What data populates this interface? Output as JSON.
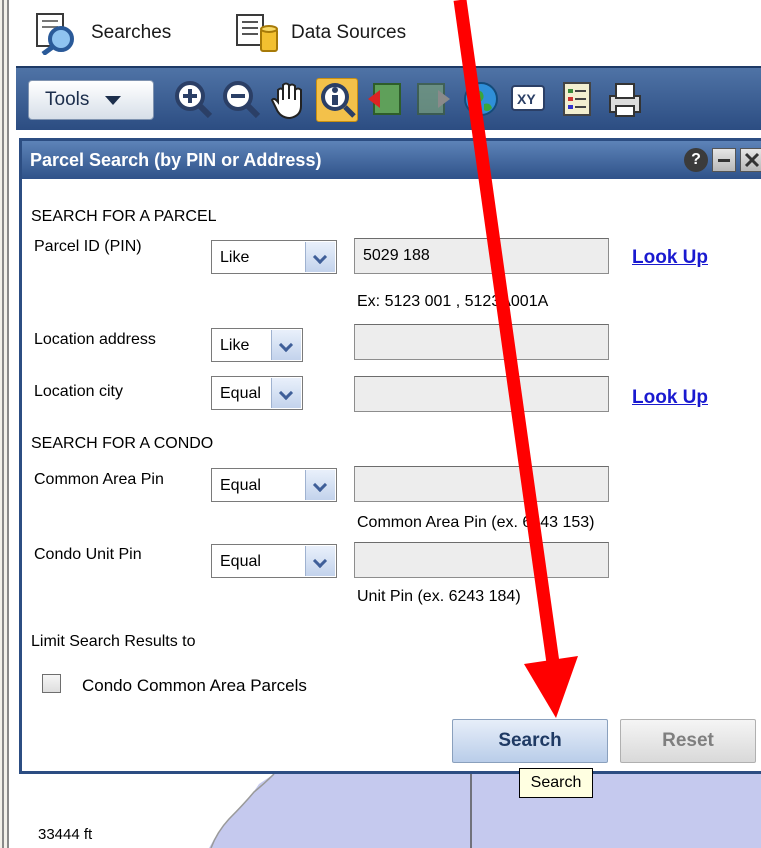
{
  "top_tabs": [
    {
      "label": "Searches",
      "icon": "search-magnifier-icon"
    },
    {
      "label": "Data Sources",
      "icon": "database-icon"
    }
  ],
  "toolbar": {
    "tools_label": "Tools",
    "tools": [
      "zoom-in-icon",
      "zoom-out-icon",
      "pan-hand-icon",
      "identify-info-icon",
      "previous-extent-icon",
      "next-extent-icon",
      "full-extent-globe-icon",
      "xy-coordinate-icon",
      "legend-list-icon",
      "print-icon"
    ],
    "active_tool": "identify-info-icon"
  },
  "panel": {
    "title": "Parcel Search (by PIN or Address)",
    "controls": [
      "help-icon",
      "minimize-icon",
      "close-icon"
    ]
  },
  "parcel_section": {
    "heading": "SEARCH FOR A PARCEL",
    "pin": {
      "label": "Parcel ID (PIN)",
      "operator": "Like",
      "value": "5029 188",
      "lookup": "Look Up",
      "hint": "Ex: 5123 001 , 5123A001A"
    },
    "address": {
      "label": "Location address",
      "operator": "Like",
      "value": ""
    },
    "city": {
      "label": "Location city",
      "operator": "Equal",
      "value": "",
      "lookup": "Look Up"
    }
  },
  "condo_section": {
    "heading": "SEARCH FOR A CONDO",
    "common_area": {
      "label": "Common Area Pin",
      "operator": "Equal",
      "value": "",
      "hint": "Common Area Pin (ex. 6243 153)"
    },
    "unit": {
      "label": "Condo Unit Pin",
      "operator": "Equal",
      "value": "",
      "hint": "Unit Pin (ex. 6243 184)"
    }
  },
  "limit": {
    "heading": "Limit Search Results to",
    "checkbox_label": "Condo Common Area Parcels",
    "checked": false
  },
  "buttons": {
    "search": "Search",
    "reset": "Reset"
  },
  "tooltip": "Search",
  "map": {
    "scale_label": "33444 ft"
  },
  "colors": {
    "accent": "#2c4d82",
    "annotation_arrow": "#ff0000",
    "link": "#1a1ad0"
  }
}
